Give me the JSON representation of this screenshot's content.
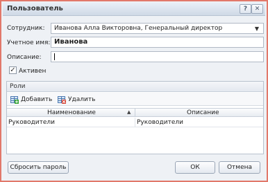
{
  "window": {
    "title": "Пользователь",
    "help_label": "?",
    "close_label": "✕"
  },
  "form": {
    "employee_label": "Сотрудник:",
    "employee_value": "Иванова Алла Викторовна, Генеральный директор",
    "account_label": "Учетное имя:",
    "account_value": "Иванова",
    "description_label": "Описание:",
    "description_value": "",
    "active_label": "Активен",
    "active_checked": true
  },
  "roles": {
    "title": "Роли",
    "add_label": "Добавить",
    "delete_label": "Удалить",
    "columns": [
      "Наименование",
      "Описание"
    ],
    "sort_indicator": "▲",
    "rows": [
      [
        "Руководители",
        "Руководители"
      ]
    ]
  },
  "footer": {
    "reset_password_label": "Сбросить пароль",
    "ok_label": "ОК",
    "cancel_label": "Отмена"
  }
}
